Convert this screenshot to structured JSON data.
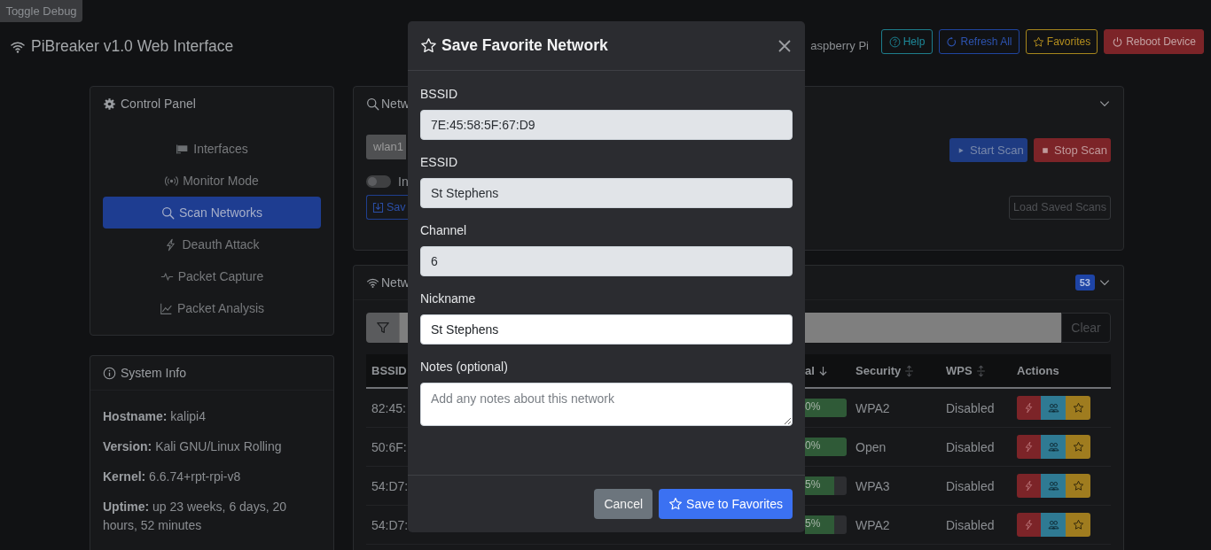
{
  "debug_button": "Toggle Debug",
  "header": {
    "title": "PiBreaker v1.0 Web Interface",
    "device": "aspberry Pi",
    "buttons": [
      {
        "label": "Help",
        "kind": "help"
      },
      {
        "label": "Refresh All",
        "kind": "refresh"
      },
      {
        "label": "Favorites",
        "kind": "favorites"
      },
      {
        "label": "Reboot Device",
        "kind": "reboot"
      }
    ]
  },
  "control_panel": {
    "title": "Control Panel",
    "items": [
      {
        "label": "Interfaces",
        "kind": "interfaces",
        "selected": false
      },
      {
        "label": "Monitor Mode",
        "kind": "monitor",
        "selected": false
      },
      {
        "label": "Scan Networks",
        "kind": "scan",
        "selected": true
      },
      {
        "label": "Deauth Attack",
        "kind": "deauth",
        "selected": false
      },
      {
        "label": "Packet Capture",
        "kind": "capture",
        "selected": false
      },
      {
        "label": "Packet Analysis",
        "kind": "analysis",
        "selected": false
      }
    ]
  },
  "system_info": {
    "title": "System Info",
    "lines": [
      "**Hostname:** kalipi4",
      "**Version:** Kali GNU/Linux Rolling",
      "**Kernel:** 6.6.74+rpt-rpi-v8",
      "**Uptime:** up 23 weeks, 6 days, 20 hours, 52 minutes"
    ]
  },
  "scan_panel": {
    "title": "Netw",
    "interface": "wlan1",
    "toggle": {
      "label": "In",
      "on": false
    },
    "save_button": "Sav",
    "buttons": [
      {
        "label": "Start Scan",
        "kind": "start"
      },
      {
        "label": "Stop Scan",
        "kind": "stop"
      }
    ],
    "load_button": "Load Saved Scans"
  },
  "networks_panel": {
    "title": "Netw",
    "count": "53",
    "clear_button": "Clear",
    "table": {
      "columns": [
        {
          "label": "BSSID",
          "kind": "plain"
        },
        {
          "label": "al",
          "kind": "sorted"
        },
        {
          "label": "Security",
          "kind": "sortable"
        },
        {
          "label": "WPS",
          "kind": "sortable"
        },
        {
          "label": "Actions",
          "kind": "plain"
        }
      ],
      "rows": [
        {
          "bssid": "82:45:",
          "signal": "0%",
          "level": 1,
          "security": "WPA2",
          "wps": "Disabled"
        },
        {
          "bssid": "50:6F:",
          "signal": "0%",
          "level": 1,
          "security": "Open",
          "wps": "Disabled"
        },
        {
          "bssid": "54:D7:",
          "signal": "5%",
          "level": 0.7,
          "security": "WPA3",
          "wps": "Disabled"
        },
        {
          "bssid": "54:D7:",
          "signal": "5%",
          "level": 0.7,
          "security": "WPA2",
          "wps": "Disabled"
        }
      ]
    }
  },
  "modal": {
    "title": "Save Favorite Network",
    "fields": [
      {
        "label": "BSSID",
        "value": "7E:45:58:5F:67:D9",
        "readonly": true,
        "kind": "input"
      },
      {
        "label": "ESSID",
        "value": "St Stephens",
        "readonly": true,
        "kind": "input"
      },
      {
        "label": "Channel",
        "value": "6",
        "readonly": true,
        "kind": "input"
      },
      {
        "label": "Nickname",
        "value": "St Stephens",
        "readonly": false,
        "kind": "input"
      },
      {
        "label": "Notes (optional)",
        "placeholder": "Add any notes about this network",
        "readonly": false,
        "kind": "textarea"
      }
    ],
    "buttons": [
      {
        "label": "Cancel",
        "kind": "secondary"
      },
      {
        "label": "Save to Favorites",
        "kind": "primary"
      }
    ]
  }
}
